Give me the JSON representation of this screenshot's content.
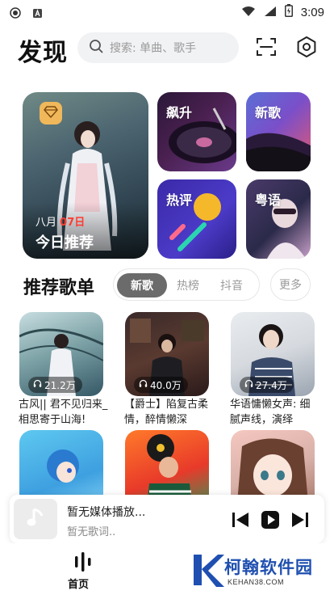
{
  "status_bar": {
    "time": "3:09",
    "icons": [
      "record-icon",
      "sim-icon",
      "wifi-icon",
      "signal-icon",
      "battery-icon"
    ]
  },
  "header": {
    "title": "发现",
    "search_placeholder": "搜索: 单曲、歌手",
    "icons": [
      "search-icon",
      "scan-icon",
      "settings-icon"
    ]
  },
  "featured": {
    "daily": {
      "month_label": "八月",
      "day": "07日",
      "label": "今日推荐",
      "badge_icon": "diamond-icon"
    },
    "tiles": [
      {
        "id": "soar",
        "label": "飙升"
      },
      {
        "id": "new",
        "label": "新歌"
      },
      {
        "id": "hot-comments",
        "label": "热评"
      },
      {
        "id": "cantonese",
        "label": "粤语"
      }
    ]
  },
  "playlists": {
    "section_title": "推荐歌单",
    "tabs": [
      {
        "label": "新歌",
        "active": true
      },
      {
        "label": "热榜",
        "active": false
      },
      {
        "label": "抖音",
        "active": false
      }
    ],
    "more_label": "更多",
    "items": [
      {
        "count": "21.2万",
        "title": "古风|| 君不见归来_相思寄于山海!"
      },
      {
        "count": "40.0万",
        "title": "【爵士】陷复古柔情，醉情懒深"
      },
      {
        "count": "27.4万",
        "title": "华语慵懒女声: 细腻声线，演绎"
      },
      {
        "count": "",
        "title": ""
      },
      {
        "count": "",
        "title": ""
      },
      {
        "count": "",
        "title": ""
      }
    ]
  },
  "player": {
    "title": "暂无媒体播放...",
    "subtitle": "暂无歌词..",
    "controls": [
      "previous-icon",
      "play-icon",
      "next-icon"
    ]
  },
  "bottom_nav": {
    "home_label": "首页",
    "home_icon": "waveform-icon"
  },
  "watermark": {
    "text": "柯翰软件园",
    "url": "KEHAN38.COM"
  },
  "colors": {
    "accent_red": "#ff3b30",
    "active_tab": "#6b6b6b",
    "watermark_blue": "#1f4fb0"
  }
}
